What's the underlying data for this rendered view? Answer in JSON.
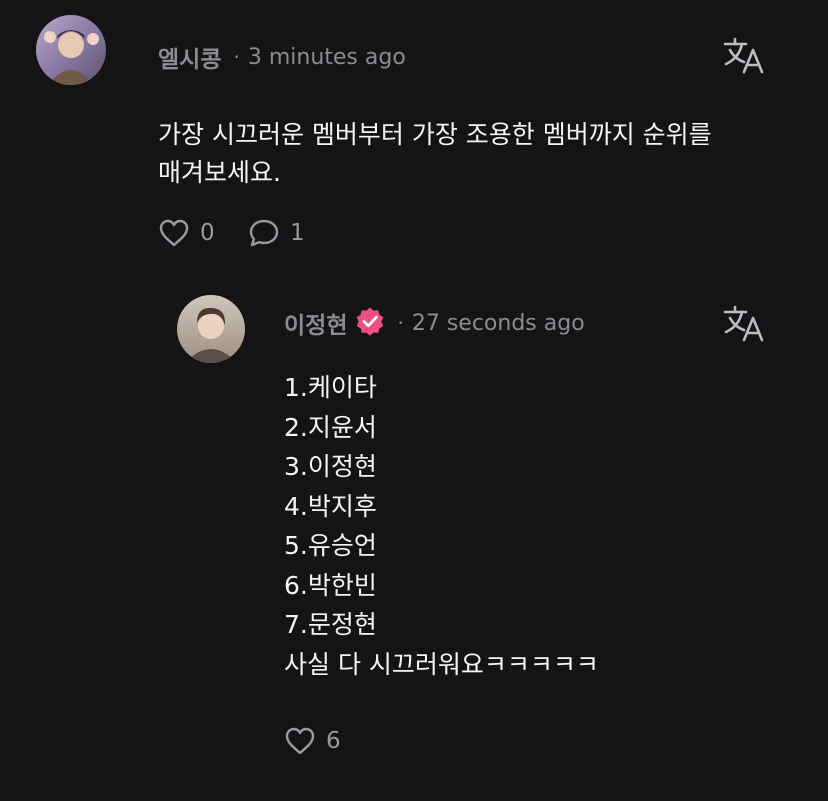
{
  "comment": {
    "author": "엘시콩",
    "separator": "·",
    "time": "3 minutes ago",
    "text": "가장 시끄러운 멤버부터 가장 조용한 멤버까지 순위를\n매겨보세요.",
    "like_count": "0",
    "reply_count": "1"
  },
  "reply": {
    "author": "이정현",
    "separator": "·",
    "time": "27 seconds ago",
    "lines": [
      "1.케이타",
      "2.지윤서",
      "3.이정현",
      "4.박지후",
      "5.유승언",
      "6.박한빈",
      "7.문정현",
      "사실 다 시끄러워요ㅋㅋㅋㅋㅋ"
    ],
    "like_count": "6"
  },
  "colors": {
    "background": "#141416",
    "muted_text": "#8c8c90",
    "verified_badge": "#ec4f86"
  },
  "icons": {
    "translate": "translate-icon",
    "like": "heart-outline-icon",
    "reply": "speech-bubble-icon",
    "verified": "verified-badge-icon"
  }
}
